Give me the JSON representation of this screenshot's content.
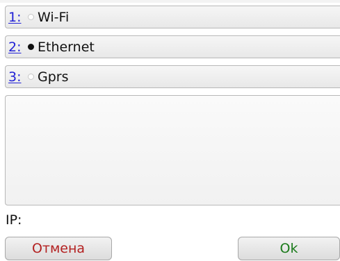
{
  "options": [
    {
      "key": "1:",
      "label": "Wi-Fi",
      "selected": false
    },
    {
      "key": "2:",
      "label": "Ethernet",
      "selected": true
    },
    {
      "key": "3:",
      "label": "Gprs",
      "selected": false
    }
  ],
  "ip": {
    "label": "IP:"
  },
  "buttons": {
    "cancel_label": "Отмена",
    "ok_label": "Ok"
  },
  "colors": {
    "accesskey": "#1f1fd6",
    "cancel_text": "#b32020",
    "ok_text": "#1a7a1a"
  }
}
